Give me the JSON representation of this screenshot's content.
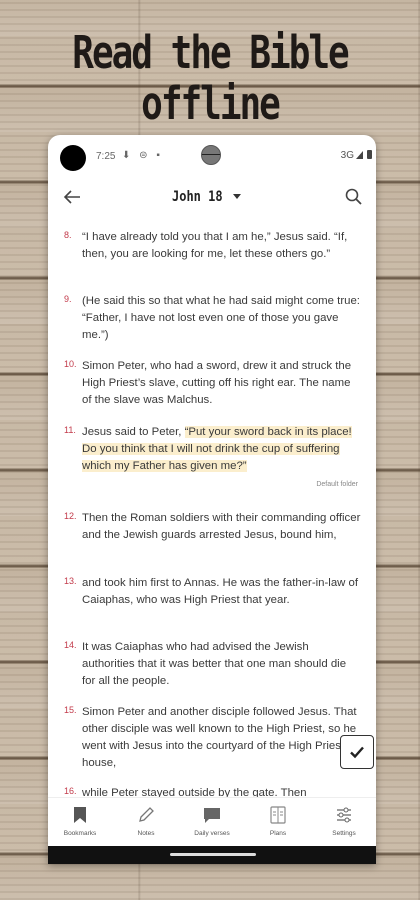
{
  "banner": {
    "text": "Read the Bible offline"
  },
  "status": {
    "time": "7:25",
    "icons_left": "⬇ ⊜ ▪",
    "network": "3G"
  },
  "appbar": {
    "title": "John 18"
  },
  "verses": [
    {
      "num": "8.",
      "text": "“I have already told you that I am he,” Jesus said. “If, then, you are looking for me, let these others go.”"
    },
    {
      "num": "9.",
      "text": "(He said this so that what he had said might come true: “Father, I have not lost even one of those you gave me.”)"
    },
    {
      "num": "10.",
      "text": "Simon Peter, who had a sword, drew it and struck the High Priest’s slave, cutting off his right ear. The name of the slave was Malchus."
    },
    {
      "num": "11.",
      "text_plain": "Jesus said to Peter, ",
      "text_highlight": "“Put your sword back in its place! Do you think that I will not drink the cup of suffering which my Father has given me?”",
      "folder": "Default folder"
    },
    {
      "num": "12.",
      "text": "Then the Roman soldiers with their commanding officer and the Jewish guards arrested Jesus, bound him,"
    },
    {
      "num": "13.",
      "text": "and took him first to Annas. He was the father-in-law of Caiaphas, who was High Priest that year."
    },
    {
      "num": "14.",
      "text": "It was Caiaphas who had advised the Jewish authorities that it was better that one man should die for all the people."
    },
    {
      "num": "15.",
      "text": "Simon Peter and another disciple followed Jesus. That other disciple was well known to the High Priest, so he went with Jesus into the courtyard of the High Priest’s house,"
    },
    {
      "num": "16.",
      "text": "while Peter stayed outside by the gate. Then"
    }
  ],
  "tabs": [
    {
      "label": "Bookmarks",
      "icon": "bookmark-icon"
    },
    {
      "label": "Notes",
      "icon": "pencil-icon"
    },
    {
      "label": "Daily verses",
      "icon": "chat-icon"
    },
    {
      "label": "Plans",
      "icon": "book-icon"
    },
    {
      "label": "Settings",
      "icon": "sliders-icon"
    }
  ],
  "colors": {
    "verse_number": "#c23a4a",
    "highlight": "#fbeecd"
  }
}
